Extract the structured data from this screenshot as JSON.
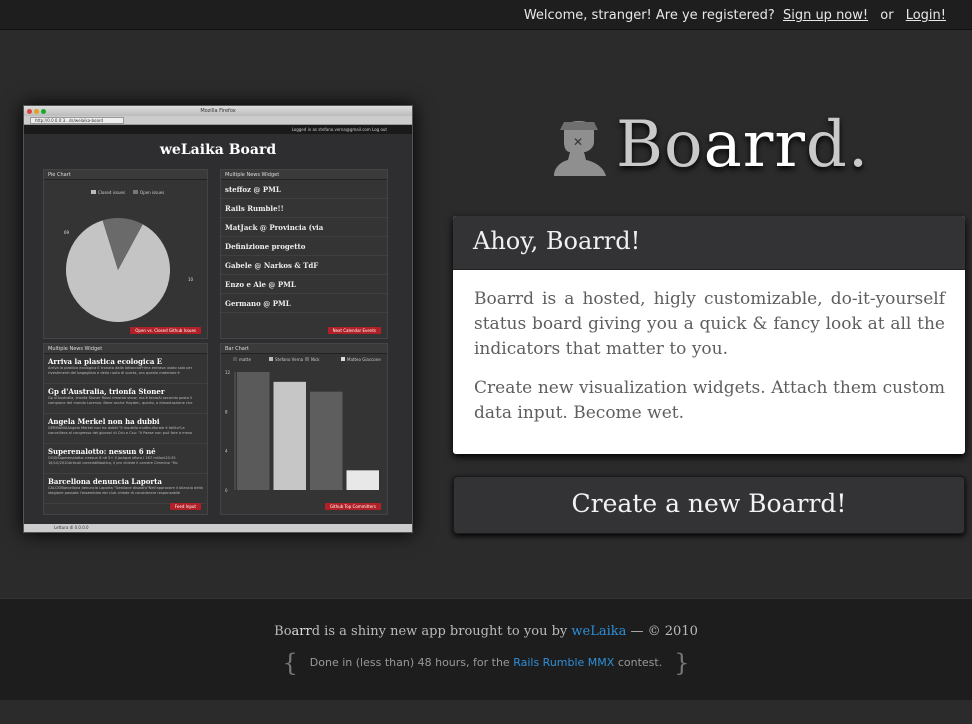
{
  "topbar": {
    "welcome": "Welcome, stranger! Are ye registered?",
    "signup": "Sign up now!",
    "or": "or",
    "login": "Login!"
  },
  "preview": {
    "window_title": "Mozilla Firefox",
    "address": "http://0.0.0.0:3...ds/welaika-board",
    "logged_in": "Logged in as stefano.verna@gmail.com  Log out",
    "board_title": "weLaika Board",
    "pie": {
      "title": "Pie Chart",
      "legend": [
        "Closed issues",
        "Open issues"
      ],
      "button": "Open vs. Closed Github Issues"
    },
    "news1": {
      "title": "Multiple News Widget",
      "items": [
        "steffoz @ PML",
        "Rails Rumble!!",
        "MatJack @ Provincia (via",
        "Definizione progetto",
        "Gabele @ Narkos & TdF",
        "Enzo e Ale @ PML",
        "Germano @ PML"
      ],
      "button": "Next Calendar Events"
    },
    "news2": {
      "title": "Multiple News Widget",
      "items": [
        {
          "title": "Arriva la plastica ecologica E",
          "text": "Arriva la plastica ecologica E tronata dalla lattaccioPrima entrava usato solo per rivestimenti del bagagliaio e della ruota di scorta, ora questo materiale è"
        },
        {
          "title": "Gp d'Australia, trionfa Stoner",
          "text": "Gp d'Australia, trionfa Stoner Rossi rimonta show, ma è terzoAl secondo posto il campione del mondo Lorenzo. Bene anche Hayden, quarto, a dimostrazione che"
        },
        {
          "title": "Angela Merkel non ha dubbi",
          "text": "GERMANIAAngela Merkel non ha dubbi \"il modello multiculturale è fallito\"La cancelliera al congresso dei giovani di Cdu e Csu: \"Il Paese non può fare a meno"
        },
        {
          "title": "Superenalotto: nessun 6 né",
          "text": "OGGISuperenalotto: nessun 6 né 5+ Il jackpot sfiora i 167 milioni20:35 16/10/2010Articoli correlatiNaotica, il pm chiede il carcere Cimmino \"Ho"
        },
        {
          "title": "Barcellona denuncia Laporta",
          "text": "CALCIOBarcellona denuncia Laporta \"Gestione disastro\"Nell'approvare il bilancio della stagione passata l'assemblea dei club chiede di considerare responsabile"
        }
      ],
      "button": "Feed Input"
    },
    "bar": {
      "title": "Bar Chart",
      "legend": [
        "matte",
        "Stefano Verna",
        "Nick",
        "Matteo Giaccone"
      ],
      "yticks": [
        "12",
        "8",
        "4",
        "0"
      ],
      "button": "Github Top Committers"
    },
    "status": "Lettura di 0.0.0.0"
  },
  "chart_data": [
    {
      "type": "pie",
      "title": "Pie Chart",
      "labels": [
        "Closed issues",
        "Open issues"
      ],
      "values": [
        69,
        10
      ]
    },
    {
      "type": "bar",
      "title": "Bar Chart",
      "categories": [
        "matte",
        "Stefano Verna",
        "Nick",
        "Matteo Giaccone"
      ],
      "values": [
        12,
        11,
        10,
        2
      ],
      "ylim": [
        0,
        12
      ]
    }
  ],
  "logo": {
    "text_a": "Bo",
    "text_b": "arr",
    "text_c": "d."
  },
  "card": {
    "title": "Ahoy, Boarrd!",
    "p1": "Boarrd is a hosted, higly customizable, do-it-yourself status board giving you a quick & fancy look at all the indicators that matter to you.",
    "p2": "Create new visualization widgets. Attach them custom data input. Become wet."
  },
  "create_button": "Create a new Boarrd!",
  "footer": {
    "brand_a": "Bo",
    "brand_b": "arr",
    "brand_c": "d",
    "line1_text": " is a shiny new app brought to you by ",
    "welaika": "weLaika",
    "line1_tail": " — © 2010",
    "line2_a": "Done in (less than) 48 hours, for the ",
    "rumble": "Rails Rumble MMX",
    "line2_b": " contest."
  },
  "colors": {
    "accent_red": "#b12026",
    "link_blue": "#2e8fd8",
    "background": "#2b2b2c"
  }
}
